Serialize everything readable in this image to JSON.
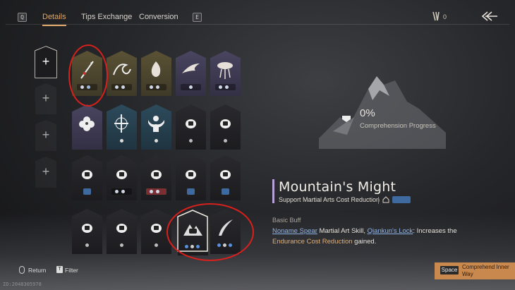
{
  "header": {
    "left_key": "Q",
    "tabs": [
      {
        "label": "Details",
        "active": true
      },
      {
        "label": "Tips Exchange",
        "active": false
      },
      {
        "label": "Conversion",
        "active": false
      }
    ],
    "right_key": "E",
    "currency_count": "0"
  },
  "slots": [
    {
      "icon": "plus-icon",
      "state": "selected"
    },
    {
      "icon": "plus-icon",
      "state": "empty"
    },
    {
      "icon": "plus-icon",
      "state": "empty"
    },
    {
      "icon": "plus-icon",
      "state": "empty"
    }
  ],
  "grid": {
    "colors": {
      "gold": "#5b5235",
      "purple": "#4a4560",
      "teal": "#2d4b5c",
      "dark": "#26262a",
      "red_tag": "#7a3033",
      "blue_tag": "#3f6aa0"
    },
    "rows": [
      [
        "spear-icon",
        "wave-icon",
        "flame-icon",
        "bird-icon",
        "storm-icon"
      ],
      [
        "flower-icon",
        "sword-cross-icon",
        "strongman-icon",
        "locked-icon",
        "locked-icon"
      ],
      [
        "locked-icon",
        "locked-icon",
        "locked-icon",
        "locked-icon",
        "locked-icon"
      ],
      [
        "locked-icon",
        "locked-icon",
        "locked-icon",
        "mountain-icon",
        "blade-icon"
      ]
    ]
  },
  "progress": {
    "percent": "0%",
    "label": "Comprehension Progress"
  },
  "skill": {
    "title": "Mountain's Might",
    "subtitle": "Support Martial Arts Cost Reduction",
    "section": "Basic Buff",
    "desc_link1": "Noname Spear",
    "desc_part1": " Martial Art Skill, ",
    "desc_link2": "Qiankun's Lock",
    "desc_part2": ": Increases the ",
    "desc_gold": "Endurance Cost Reduction",
    "desc_part3": " gained."
  },
  "footer": {
    "return_label": "Return",
    "filter_key": "T",
    "filter_label": "Filter",
    "watermark": "ID:2048305978",
    "action_key": "Space",
    "action_label": "Comprehend Inner Way"
  }
}
